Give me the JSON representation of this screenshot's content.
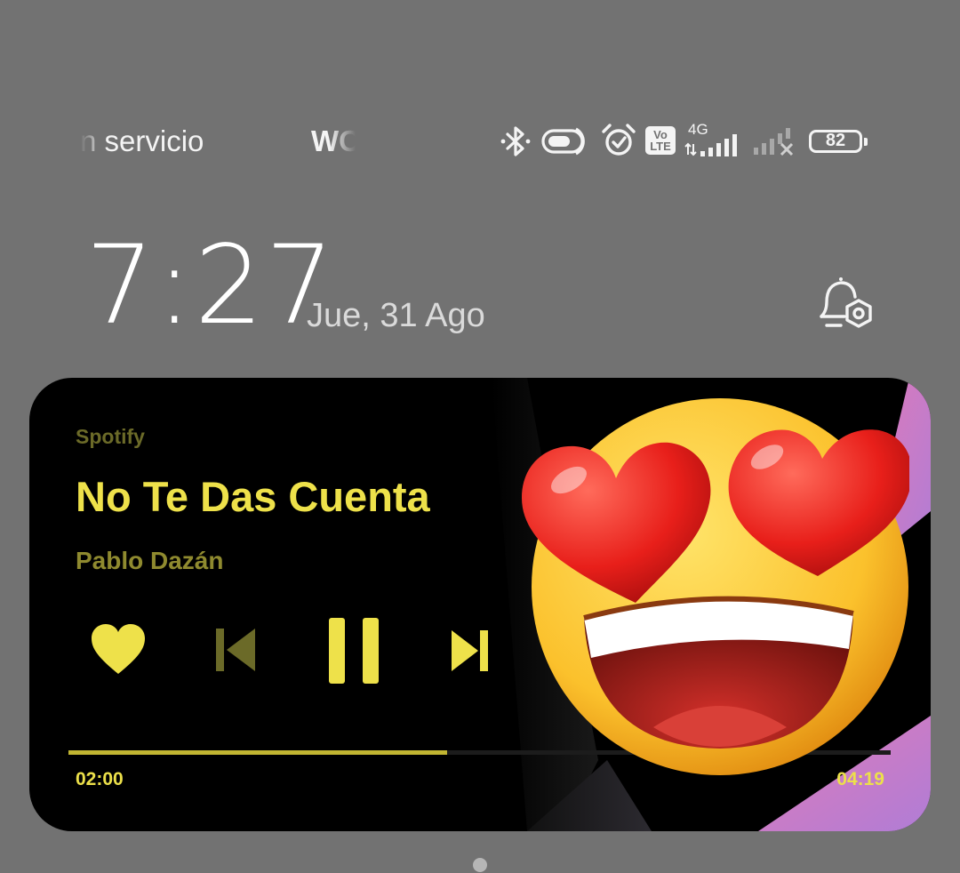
{
  "status_bar": {
    "carrier": "n servicio",
    "ticker": "WC",
    "battery_level": "82",
    "network_type": "4G",
    "volte_top": "Vo",
    "volte_bottom": "LTE",
    "icons": [
      "bluetooth-icon",
      "data-saver-icon",
      "alarm-icon",
      "volte-icon",
      "signal-4g-icon",
      "signal-no-service-icon",
      "battery-icon"
    ]
  },
  "lockscreen": {
    "time": "7:27",
    "date": "Jue, 31 Ago",
    "notification_settings_icon": "bell-gear-icon"
  },
  "player": {
    "app": "Spotify",
    "title": "No Te Das Cuenta",
    "artist": "Pablo Dazán",
    "elapsed": "02:00",
    "total": "04:19",
    "progress": 0.46,
    "accent_color": "#eee14a",
    "controls": [
      "heart-icon",
      "previous-icon",
      "pause-icon",
      "next-icon"
    ]
  },
  "overlay": {
    "emoji": "heart-eyes-emoji"
  }
}
